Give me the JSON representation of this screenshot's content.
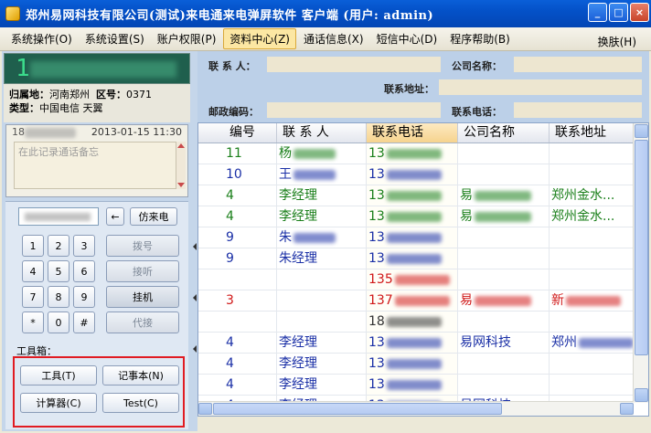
{
  "window": {
    "title": "郑州易网科技有限公司(测试)来电通来电弹屏软件 客户端 (用户: admin)",
    "controls": {
      "minimize": "_",
      "maximize": "□",
      "close": "×"
    }
  },
  "menu": {
    "items": [
      "系统操作(O)",
      "系统设置(S)",
      "账户权限(P)",
      "资料中心(Z)",
      "通话信息(X)",
      "短信中心(D)",
      "程序帮助(B)"
    ],
    "active_index": 3,
    "right": "换肤(H)"
  },
  "caller": {
    "number_prefix": "1",
    "location_label": "归属地：",
    "location": "河南郑州",
    "areacode_label": "区号：",
    "areacode": "0371",
    "type_label": "类型：",
    "type": "中国电信 天翼"
  },
  "memo": {
    "number_prefix": "18",
    "datetime": "2013-01-15 11:30",
    "placeholder": "在此记录通话备忘"
  },
  "dialpad": {
    "back_label": "←",
    "fake_call_label": "仿来电",
    "keys": [
      "1",
      "2",
      "3",
      "4",
      "5",
      "6",
      "7",
      "8",
      "9",
      "*",
      "0",
      "#"
    ],
    "dial_label": "拨号",
    "answer_label": "接听",
    "hangup_label": "挂机",
    "forward_label": "代接"
  },
  "toolbox": {
    "label": "工具箱：",
    "tools_label": "工具(T)",
    "notepad_label": "记事本(N)",
    "calculator_label": "计算器(C)",
    "test_label": "Test(C)"
  },
  "form": {
    "contact_label": "联 系 人：",
    "company_label": "公司名称：",
    "address_label": "联系地址：",
    "postcode_label": "邮政编码：",
    "phone_label": "联系电话："
  },
  "table": {
    "columns": [
      "编号",
      "联 系 人",
      "联系电话",
      "公司名称",
      "联系地址"
    ],
    "selected_column": 2,
    "rows": [
      {
        "id": "11",
        "contact": "杨",
        "phone": "13",
        "company": "",
        "address": "",
        "color": "#1a7f1a"
      },
      {
        "id": "10",
        "contact": "王",
        "phone": "13",
        "company": "",
        "address": "",
        "color": "#1a2fa6"
      },
      {
        "id": "4",
        "contact": "李经理",
        "phone": "13",
        "company": "易",
        "address": "郑州金水...",
        "color": "#1a7f1a"
      },
      {
        "id": "4",
        "contact": "李经理",
        "phone": "13",
        "company": "易",
        "address": "郑州金水...",
        "color": "#1a7f1a"
      },
      {
        "id": "9",
        "contact": "朱",
        "phone": "13",
        "company": "",
        "address": "",
        "color": "#1a2fa6"
      },
      {
        "id": "9",
        "contact": "朱经理",
        "phone": "13",
        "company": "",
        "address": "",
        "color": "#1a2fa6"
      },
      {
        "id": "",
        "contact": "",
        "phone": "135",
        "company": "",
        "address": "",
        "color": "#d01818"
      },
      {
        "id": "3",
        "contact": "",
        "phone": "137",
        "company": "易",
        "address": "新",
        "color": "#d01818"
      },
      {
        "id": "",
        "contact": "",
        "phone": "18",
        "company": "",
        "address": "",
        "color": "#333333"
      },
      {
        "id": "4",
        "contact": "李经理",
        "phone": "13",
        "company": "易网科技",
        "address": "郑州",
        "color": "#1a2fa6"
      },
      {
        "id": "4",
        "contact": "李经理",
        "phone": "13",
        "company": "",
        "address": "",
        "color": "#1a2fa6"
      },
      {
        "id": "4",
        "contact": "李经理",
        "phone": "13",
        "company": "",
        "address": "",
        "color": "#1a2fa6"
      },
      {
        "id": "4",
        "contact": "李经理",
        "phone": "13",
        "company": "易网科技",
        "address": "",
        "color": "#1a2fa6"
      }
    ]
  }
}
